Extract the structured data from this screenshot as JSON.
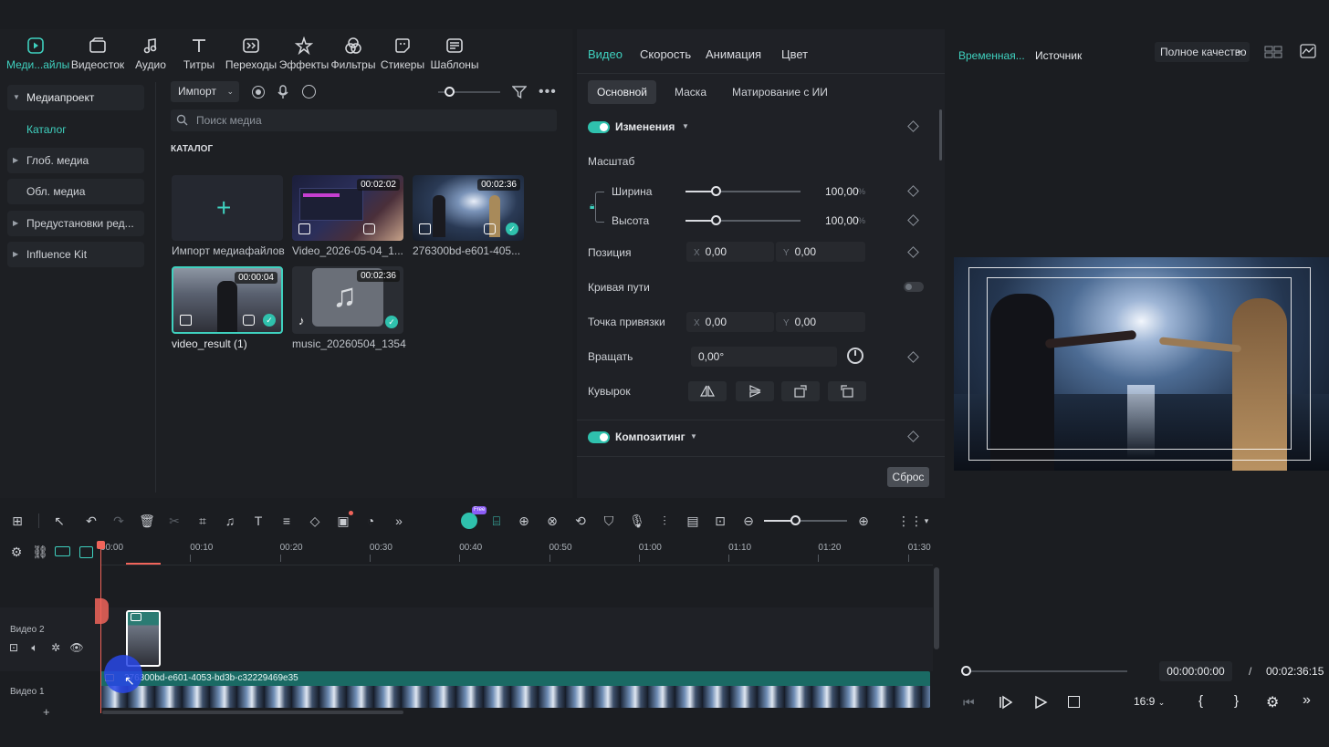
{
  "toolbar": {
    "tools": [
      {
        "label": "Меди...айлы",
        "icon": "media-icon",
        "active": true
      },
      {
        "label": "Видеосток",
        "icon": "stock-icon"
      },
      {
        "label": "Аудио",
        "icon": "music-note-icon"
      },
      {
        "label": "Титры",
        "icon": "title-text-icon"
      },
      {
        "label": "Переходы",
        "icon": "transitions-icon"
      },
      {
        "label": "Эффекты",
        "icon": "effects-icon"
      },
      {
        "label": "Фильтры",
        "icon": "filters-icon"
      },
      {
        "label": "Стикеры",
        "icon": "stickers-icon"
      },
      {
        "label": "Шаблоны",
        "icon": "templates-icon"
      }
    ]
  },
  "sidebar": {
    "items": [
      {
        "label": "Медиапроект",
        "expandable": true
      },
      {
        "label": "Каталог",
        "active": true
      },
      {
        "label": "Глоб. медиа",
        "expandable": true
      },
      {
        "label": "Обл. медиа"
      },
      {
        "label": "Предустановки ред...",
        "expandable": true
      },
      {
        "label": "Influence Kit",
        "expandable": true
      }
    ]
  },
  "media": {
    "import_label": "Импорт",
    "search_placeholder": "Поиск медиа",
    "section_title": "КАТАЛОГ",
    "import_tile_label": "Импорт медиафайлов",
    "items": [
      {
        "name": "Video_2026-05-04_1...",
        "duration": "00:02:02"
      },
      {
        "name": "276300bd-e601-405...",
        "duration": "00:02:36"
      },
      {
        "name": "video_result (1)",
        "duration": "00:00:04"
      },
      {
        "name": "music_20260504_1354",
        "duration": "00:02:36"
      }
    ]
  },
  "properties": {
    "tabs": [
      "Видео",
      "Скорость",
      "Анимация",
      "Цвет"
    ],
    "subtabs": [
      "Основной",
      "Маска",
      "Матирование с ИИ"
    ],
    "section_changes": "Изменения",
    "scale_label": "Масштаб",
    "width_label": "Ширина",
    "width_value": "100,00",
    "height_label": "Высота",
    "height_value": "100,00",
    "percent": "%",
    "position_label": "Позиция",
    "pos_x": "0,00",
    "pos_y": "0,00",
    "x_label": "X",
    "y_label": "Y",
    "path_curve_label": "Кривая пути",
    "anchor_label": "Точка привязки",
    "anchor_x": "0,00",
    "anchor_y": "0,00",
    "rotate_label": "Вращать",
    "rotate_value": "0,00°",
    "flip_label": "Кувырок",
    "section_compositing": "Композитинг",
    "reset_label": "Сброс"
  },
  "preview": {
    "tab_timeline": "Временная...",
    "tab_source": "Источник",
    "quality_label": "Полное качество",
    "current_time": "00:00:00:00",
    "separator": "/",
    "total_time": "00:02:36:15",
    "aspect": "16:9"
  },
  "timeline": {
    "ai_badge": "Free",
    "ruler": [
      "00:00",
      "00:10",
      "00:20",
      "00:30",
      "00:40",
      "00:50",
      "01:00",
      "01:10",
      "01:20",
      "01:30"
    ],
    "track_video2": "Видео 2",
    "track_video1": "Видео 1",
    "clip_label": "276300bd-e601-4053-bd3b-c32229469e35"
  },
  "colors": {
    "accent": "#3fd1bf",
    "panel": "#1f2126",
    "playhead": "#f0645a"
  }
}
